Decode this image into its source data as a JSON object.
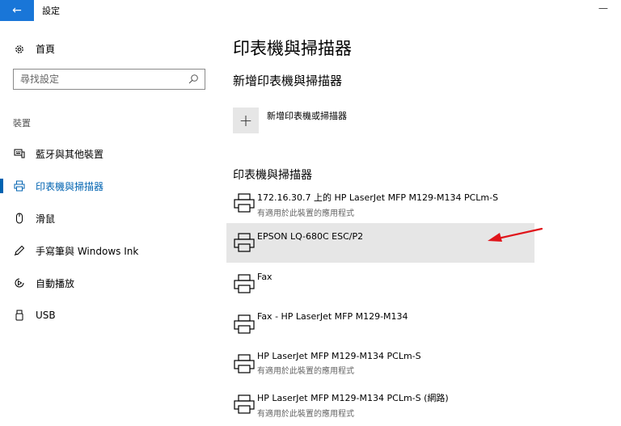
{
  "window": {
    "title": "設定",
    "back_glyph": "←",
    "minimize_glyph": "—"
  },
  "sidebar": {
    "home_label": "首頁",
    "search_placeholder": "尋找設定",
    "section_label": "裝置",
    "items": [
      {
        "label": "藍牙與其他裝置",
        "icon": "bluetooth-devices-icon",
        "active": false
      },
      {
        "label": "印表機與掃描器",
        "icon": "printer-icon",
        "active": true
      },
      {
        "label": "滑鼠",
        "icon": "mouse-icon",
        "active": false
      },
      {
        "label": "手寫筆與 Windows Ink",
        "icon": "pen-icon",
        "active": false
      },
      {
        "label": "自動播放",
        "icon": "autoplay-icon",
        "active": false
      },
      {
        "label": "USB",
        "icon": "usb-icon",
        "active": false
      }
    ]
  },
  "main": {
    "title": "印表機與掃描器",
    "add_section_title": "新增印表機與掃描器",
    "add_button_label": "新增印表機或掃描器",
    "add_glyph": "+",
    "list_title": "印表機與掃描器",
    "printers": [
      {
        "name": "172.16.30.7 上的 HP LaserJet MFP M129-M134 PCLm-S",
        "subtitle": "有適用於此裝置的應用程式",
        "selected": false
      },
      {
        "name": "EPSON LQ-680C ESC/P2",
        "subtitle": "",
        "selected": true
      },
      {
        "name": "Fax",
        "subtitle": "",
        "selected": false
      },
      {
        "name": "Fax - HP LaserJet MFP M129-M134",
        "subtitle": "",
        "selected": false
      },
      {
        "name": "HP LaserJet MFP M129-M134 PCLm-S",
        "subtitle": "有適用於此裝置的應用程式",
        "selected": false
      },
      {
        "name": "HP LaserJet MFP M129-M134 PCLm-S (網路)",
        "subtitle": "有適用於此裝置的應用程式",
        "selected": false
      }
    ]
  },
  "colors": {
    "accent": "#0063b1",
    "title_bar_button": "#1976d8",
    "selection": "#e6e6e6",
    "annotation_arrow": "#e0151b"
  }
}
